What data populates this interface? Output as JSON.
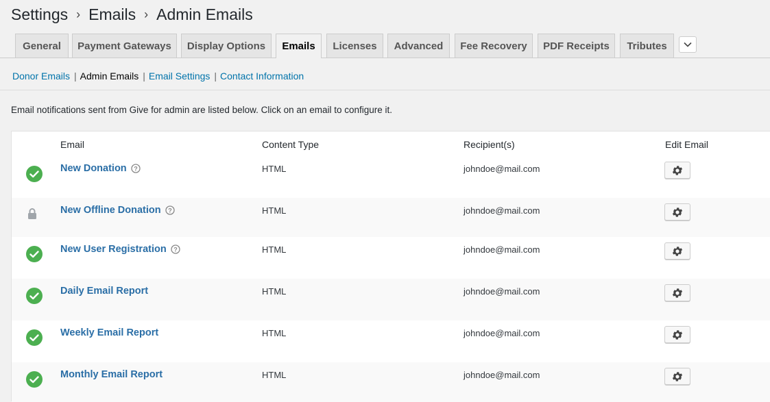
{
  "breadcrumb": {
    "items": [
      "Settings",
      "Emails",
      "Admin Emails"
    ],
    "separator": "›"
  },
  "tabs": [
    {
      "label": "General"
    },
    {
      "label": "Payment Gateways"
    },
    {
      "label": "Display Options"
    },
    {
      "label": "Emails",
      "active": true
    },
    {
      "label": "Licenses"
    },
    {
      "label": "Advanced"
    },
    {
      "label": "Fee Recovery"
    },
    {
      "label": "PDF Receipts"
    },
    {
      "label": "Tributes"
    }
  ],
  "tabs_more_icon": "chevron-down-icon",
  "subnav": [
    {
      "label": "Donor Emails",
      "current": false
    },
    {
      "label": "Admin Emails",
      "current": true
    },
    {
      "label": "Email Settings",
      "current": false
    },
    {
      "label": "Contact Information",
      "current": false
    }
  ],
  "description": "Email notifications sent from Give for admin are listed below. Click on an email to configure it.",
  "table": {
    "columns": [
      "Email",
      "Content Type",
      "Recipient(s)",
      "Edit Email"
    ],
    "rows": [
      {
        "status": "enabled",
        "name": "New Donation",
        "help": true,
        "content_type": "HTML",
        "recipient": "johndoe@mail.com"
      },
      {
        "status": "locked",
        "name": "New Offline Donation",
        "help": true,
        "content_type": "HTML",
        "recipient": "johndoe@mail.com"
      },
      {
        "status": "enabled",
        "name": "New User Registration",
        "help": true,
        "content_type": "HTML",
        "recipient": "johndoe@mail.com"
      },
      {
        "status": "enabled",
        "name": "Daily Email Report",
        "help": false,
        "content_type": "HTML",
        "recipient": "johndoe@mail.com"
      },
      {
        "status": "enabled",
        "name": "Weekly Email Report",
        "help": false,
        "content_type": "HTML",
        "recipient": "johndoe@mail.com"
      },
      {
        "status": "enabled",
        "name": "Monthly Email Report",
        "help": false,
        "content_type": "HTML",
        "recipient": "johndoe@mail.com"
      }
    ]
  },
  "colors": {
    "link": "#2a6ea6",
    "enabled": "#4caf50",
    "locked": "#a0a5aa",
    "page_bg": "#f1f1f1"
  }
}
